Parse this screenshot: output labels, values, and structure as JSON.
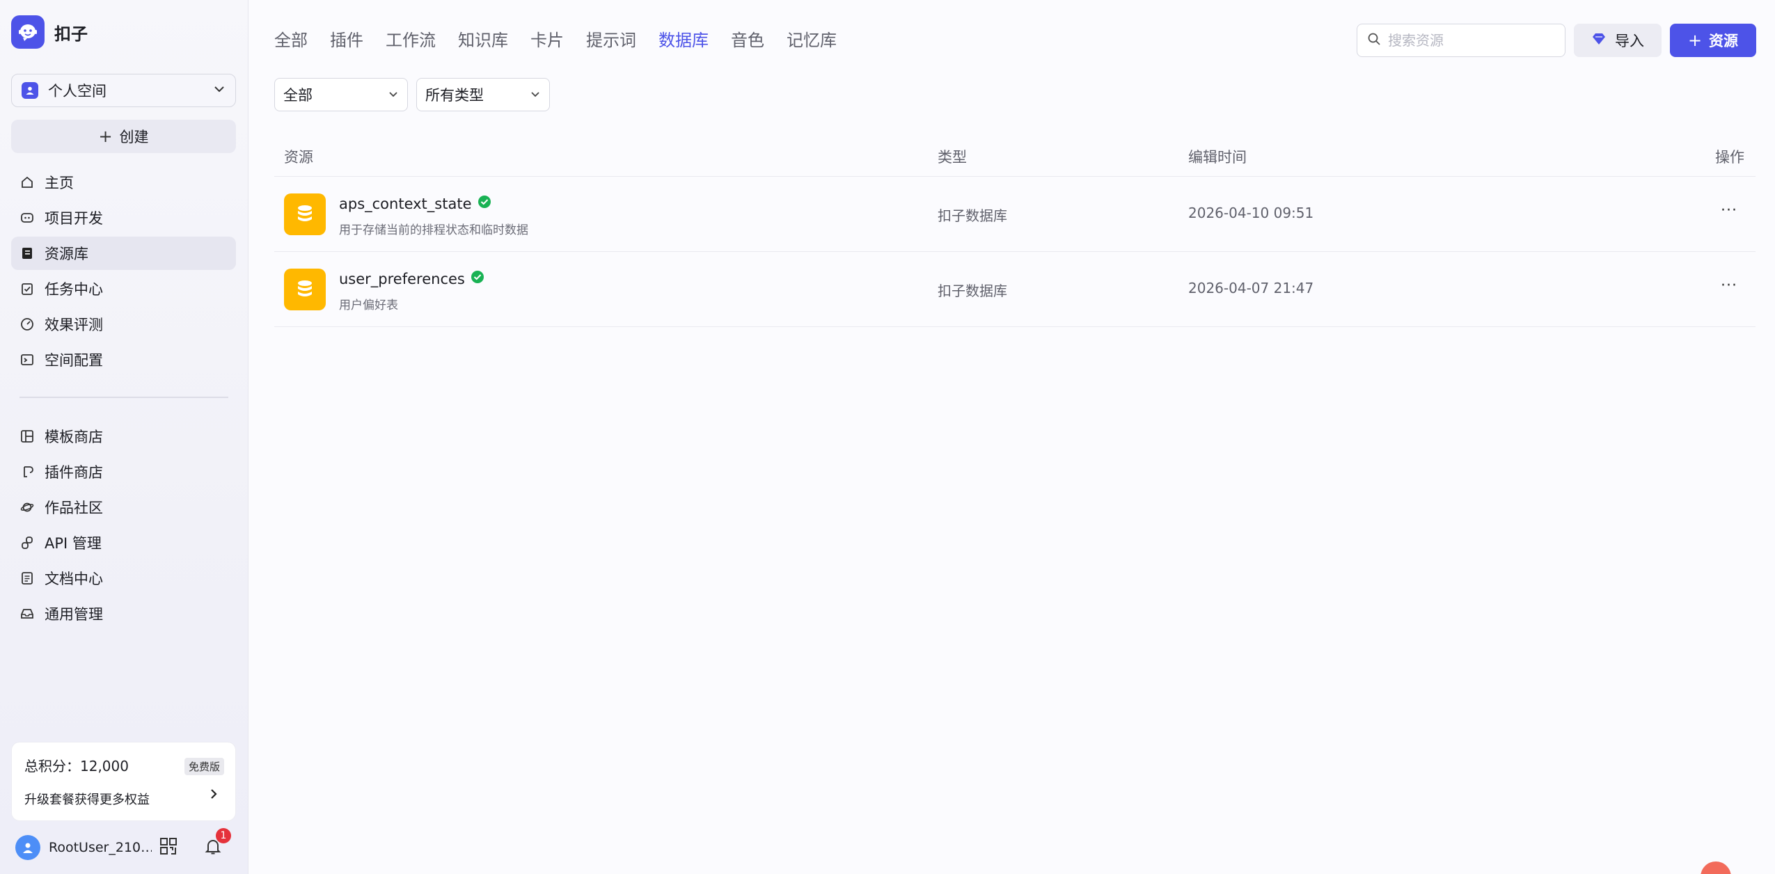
{
  "brand": {
    "name": "扣子"
  },
  "space": {
    "label": "个人空间"
  },
  "create": {
    "label": "创建"
  },
  "nav_main": [
    {
      "label": "主页",
      "icon": "home-icon"
    },
    {
      "label": "项目开发",
      "icon": "bot-icon"
    },
    {
      "label": "资源库",
      "icon": "library-icon",
      "active": true
    },
    {
      "label": "任务中心",
      "icon": "task-icon"
    },
    {
      "label": "效果评测",
      "icon": "gauge-icon"
    },
    {
      "label": "空间配置",
      "icon": "terminal-icon"
    }
  ],
  "nav_secondary": [
    {
      "label": "模板商店",
      "icon": "template-icon"
    },
    {
      "label": "插件商店",
      "icon": "plugin-icon"
    },
    {
      "label": "作品社区",
      "icon": "planet-icon"
    },
    {
      "label": "API 管理",
      "icon": "link-icon"
    },
    {
      "label": "文档中心",
      "icon": "document-icon"
    },
    {
      "label": "通用管理",
      "icon": "inbox-icon"
    }
  ],
  "points": {
    "total_label": "总积分：12,000",
    "plan_badge": "免费版",
    "upgrade_label": "升级套餐获得更多权益"
  },
  "user": {
    "name": "RootUser_210…",
    "notifications": "1"
  },
  "tabs": [
    "全部",
    "插件",
    "工作流",
    "知识库",
    "卡片",
    "提示词",
    "数据库",
    "音色",
    "记忆库"
  ],
  "active_tab": "数据库",
  "search": {
    "placeholder": "搜索资源"
  },
  "toolbar": {
    "import_label": "导入",
    "resource_label": "资源"
  },
  "filters": {
    "scope": "全部",
    "type": "所有类型"
  },
  "table": {
    "headers": {
      "resource": "资源",
      "type": "类型",
      "edit_time": "编辑时间",
      "actions": "操作"
    },
    "rows": [
      {
        "name": "aps_context_state",
        "desc": "用于存储当前的排程状态和临时数据",
        "type": "扣子数据库",
        "time": "2026-04-10 09:51",
        "more": "···"
      },
      {
        "name": "user_preferences",
        "desc": "用户偏好表",
        "type": "扣子数据库",
        "time": "2026-04-07 21:47",
        "more": "···"
      }
    ]
  },
  "colors": {
    "accent": "#4d53e8",
    "db_icon": "#ffb800",
    "success": "#19b254",
    "badge": "#e5323b"
  }
}
